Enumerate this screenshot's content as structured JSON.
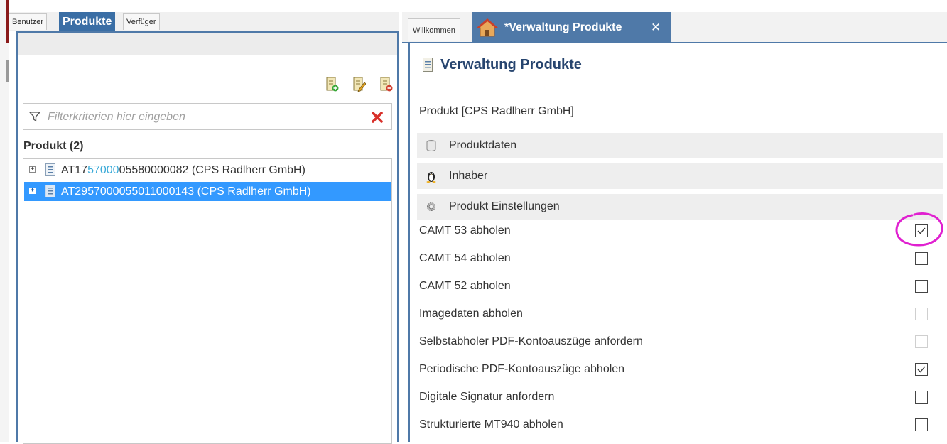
{
  "left": {
    "tabs": [
      {
        "label": "Benutzer",
        "active": false
      },
      {
        "label": "Produkte",
        "active": true
      },
      {
        "label": "Verfüger",
        "active": false
      }
    ],
    "toolbar_icons": [
      "add-product-icon",
      "edit-product-icon",
      "delete-product-icon"
    ],
    "filter": {
      "placeholder": "Filterkriterien hier eingeben",
      "value": ""
    },
    "list_heading": "Produkt (2)",
    "items": [
      {
        "prefix": "AT17",
        "highlight": "57000",
        "rest": "05580000082 (CPS Radlherr GmbH)",
        "expander": "+",
        "selected": false
      },
      {
        "prefix": "AT29",
        "highlight": "57000",
        "rest": "055011000143 (CPS Radlherr GmbH)",
        "expander": "+",
        "selected": true
      }
    ]
  },
  "right": {
    "tabs": [
      {
        "label": "Willkommen",
        "active": false
      },
      {
        "label": "*Verwaltung Produkte",
        "active": true,
        "close": "✕"
      }
    ],
    "title": "Verwaltung Produkte",
    "subtitle": "Produkt [CPS Radlherr GmbH]",
    "sections": [
      {
        "label": "Produktdaten",
        "icon": "database-icon"
      },
      {
        "label": "Inhaber",
        "icon": "owner-icon"
      },
      {
        "label": "Produkt Einstellungen",
        "icon": "gear-icon"
      }
    ],
    "settings": [
      {
        "label": "CAMT 53 abholen",
        "checked": true,
        "disabled": false
      },
      {
        "label": "CAMT 54 abholen",
        "checked": false,
        "disabled": false
      },
      {
        "label": "CAMT 52 abholen",
        "checked": false,
        "disabled": false
      },
      {
        "label": "Imagedaten abholen",
        "checked": false,
        "disabled": true
      },
      {
        "label": "Selbstabholer PDF-Kontoauszüge anfordern",
        "checked": false,
        "disabled": true
      },
      {
        "label": "Periodische PDF-Kontoauszüge abholen",
        "checked": true,
        "disabled": false
      },
      {
        "label": "Digitale Signatur anfordern",
        "checked": false,
        "disabled": false
      },
      {
        "label": "Strukturierte MT940 abholen",
        "checked": false,
        "disabled": false
      }
    ]
  },
  "colors": {
    "accent": "#4f79a8",
    "selection": "#3399ff",
    "title": "#27456f",
    "highlight": "#3aaad8",
    "annotation": "#e020d0"
  }
}
